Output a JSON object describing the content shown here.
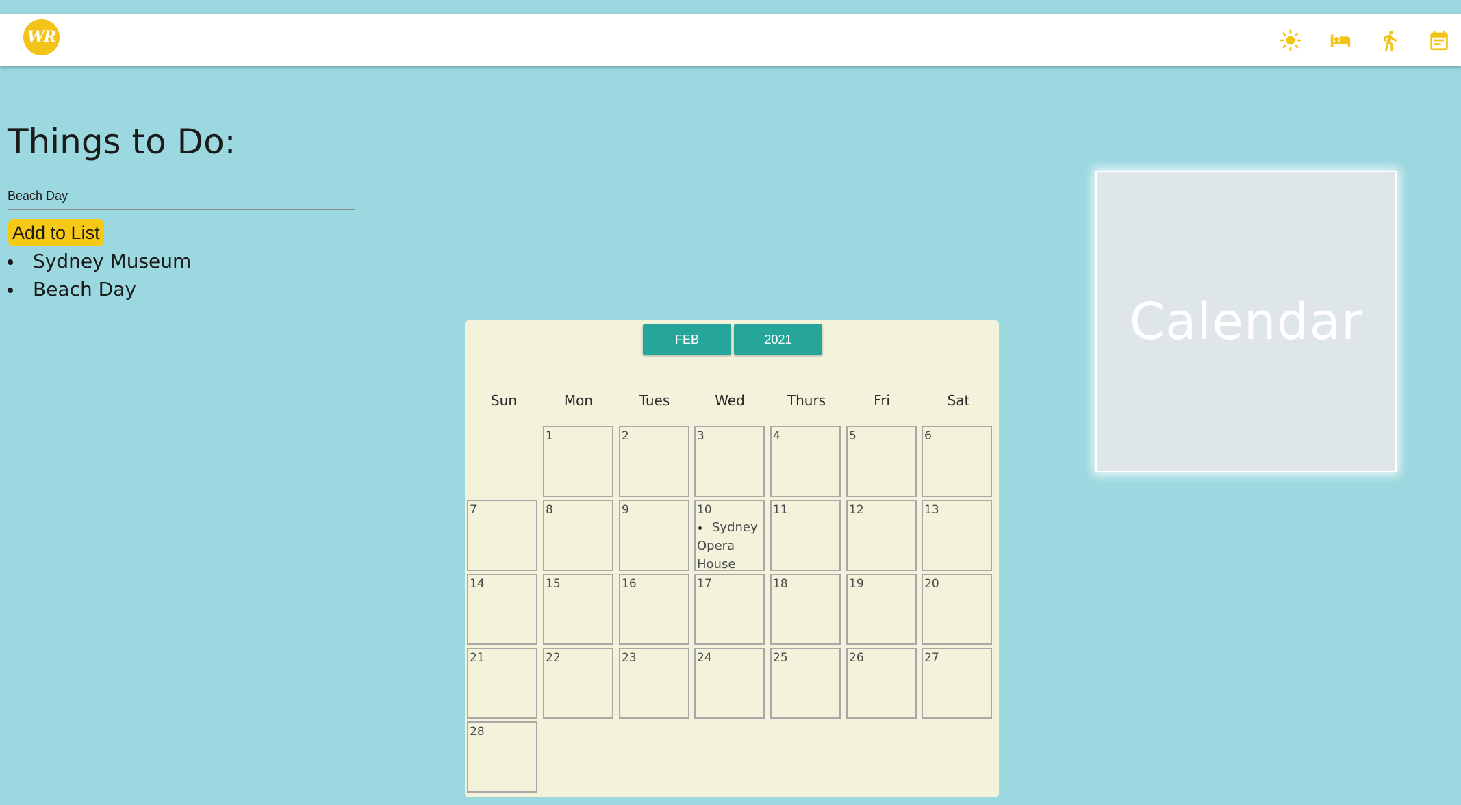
{
  "header": {
    "logo_text": "WR",
    "nav_icons": [
      "sun-icon",
      "hotel-bed-icon",
      "walking-person-icon",
      "calendar-icon"
    ],
    "accent_color": "#f2c41a"
  },
  "todo": {
    "title": "Things to Do:",
    "input_value": "Beach Day",
    "add_button_label": "Add to List",
    "items": [
      "Sydney Museum",
      "Beach Day"
    ]
  },
  "calendar": {
    "month_button": "FEB",
    "year_button": "2021",
    "weekdays": [
      "Sun",
      "Mon",
      "Tues",
      "Wed",
      "Thurs",
      "Fri",
      "Sat"
    ],
    "first_weekday_index": 1,
    "days_in_month": 28,
    "events": {
      "10": [
        "Sydney Opera House"
      ]
    },
    "background_color": "#f3f3dc",
    "button_color": "#26a69a"
  },
  "calendar_card": {
    "label": "Calendar"
  }
}
